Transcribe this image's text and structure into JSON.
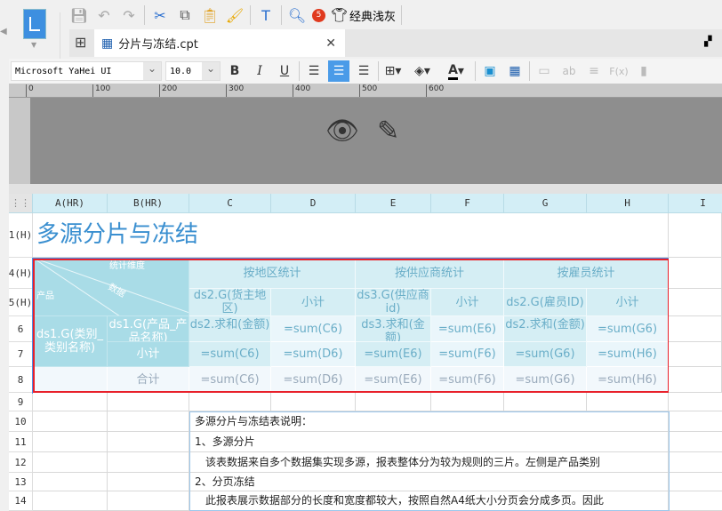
{
  "toolbar": {
    "badge": "5",
    "theme_label": "经典浅灰"
  },
  "tab": {
    "title": "分片与冻结.cpt"
  },
  "format": {
    "font": "Microsoft YaHei UI",
    "size": "10.0",
    "bold": "B",
    "italic": "I",
    "underline": "U",
    "font_color": "A"
  },
  "ruler": [
    "0",
    "100",
    "200",
    "300",
    "400",
    "500",
    "600"
  ],
  "columns": [
    "A(HR)",
    "B(HR)",
    "C",
    "D",
    "E",
    "F",
    "G",
    "H",
    "I"
  ],
  "rows": [
    "1(H)",
    "4(H)",
    "5(H)",
    "6",
    "7",
    "8",
    "9",
    "10",
    "11",
    "12",
    "13",
    "14"
  ],
  "sheet": {
    "title": "多源分片与冻结",
    "corner_dim": "统计维度",
    "corner_data": "数据",
    "corner_product": "产品",
    "region": "按地区统计",
    "supplier": "按供应商统计",
    "employee": "按雇员统计",
    "c5": "ds2.G(货主地区)",
    "d5": "小计",
    "e5": "ds3.G(供应商id)",
    "f5": "小计",
    "g5": "ds2.G(雇员ID)",
    "h5": "小计",
    "a6": "ds1.G(类别_类别名称)",
    "b6": "ds1.G(产品_产品名称)",
    "c6": "ds2.求和(金额)",
    "d6": "=sum(C6)",
    "e6": "ds3.求和(金额)",
    "f6": "=sum(E6)",
    "g6": "ds2.求和(金额)",
    "h6": "=sum(G6)",
    "b7": "小计",
    "c7": "=sum(C6)",
    "d7": "=sum(D6)",
    "e7": "=sum(E6)",
    "f7": "=sum(F6)",
    "g7": "=sum(G6)",
    "h7": "=sum(H6)",
    "b8": "合计",
    "c8": "=sum(C6)",
    "d8": "=sum(D6)",
    "e8": "=sum(E6)",
    "f8": "=sum(F6)",
    "g8": "=sum(G6)",
    "h8": "=sum(H6)",
    "c10": "多源分片与冻结表说明：",
    "c11": "1、多源分片",
    "c12": "　该表数据来自多个数据集实现多源，报表整体分为较为规则的三片。左侧是产品类别",
    "c13": "2、分页冻结",
    "c14": "　此报表展示数据部分的长度和宽度都较大，按照自然A4纸大小分页会分成多页。因此"
  }
}
